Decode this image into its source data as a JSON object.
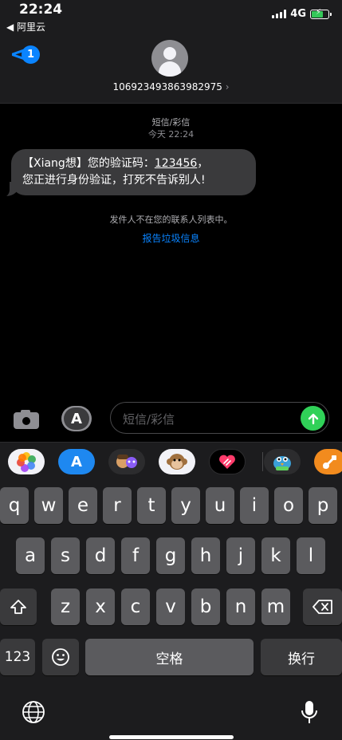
{
  "status_bar": {
    "time": "22:24",
    "back_app": "◀ 阿里云",
    "network": "4G"
  },
  "header": {
    "badge": "1",
    "contact_number": "106923493863982975",
    "contact_chevron": "›"
  },
  "conversation": {
    "service": "短信/彩信",
    "timestamp": "今天 22:24",
    "message": {
      "line1_prefix": "【Xiang想】您的验证码：",
      "code": "123456",
      "line1_suffix": "，",
      "line2": "您正进行身份验证，打死不告诉别人!"
    },
    "notice": "发件人不在您的联系人列表中。",
    "report_link": "报告垃圾信息"
  },
  "compose": {
    "placeholder": "短信/彩信",
    "send_icon": "arrow-up-icon"
  },
  "app_strip": [
    {
      "name": "photos-app-icon"
    },
    {
      "name": "app-store-icon"
    },
    {
      "name": "memoji-stickers-icon"
    },
    {
      "name": "animoji-monkey-icon"
    },
    {
      "name": "digital-touch-icon"
    },
    {
      "name": "game-pigeon-icon"
    },
    {
      "name": "garageband-icon"
    }
  ],
  "keyboard": {
    "row1": [
      "q",
      "w",
      "e",
      "r",
      "t",
      "y",
      "u",
      "i",
      "o",
      "p"
    ],
    "row2": [
      "a",
      "s",
      "d",
      "f",
      "g",
      "h",
      "j",
      "k",
      "l"
    ],
    "row3": [
      "z",
      "x",
      "c",
      "v",
      "b",
      "n",
      "m"
    ],
    "numbers": "123",
    "space": "空格",
    "return": "换行"
  },
  "colors": {
    "accent": "#0a84ff",
    "send": "#30d158",
    "bubble": "#3a3a3c"
  }
}
